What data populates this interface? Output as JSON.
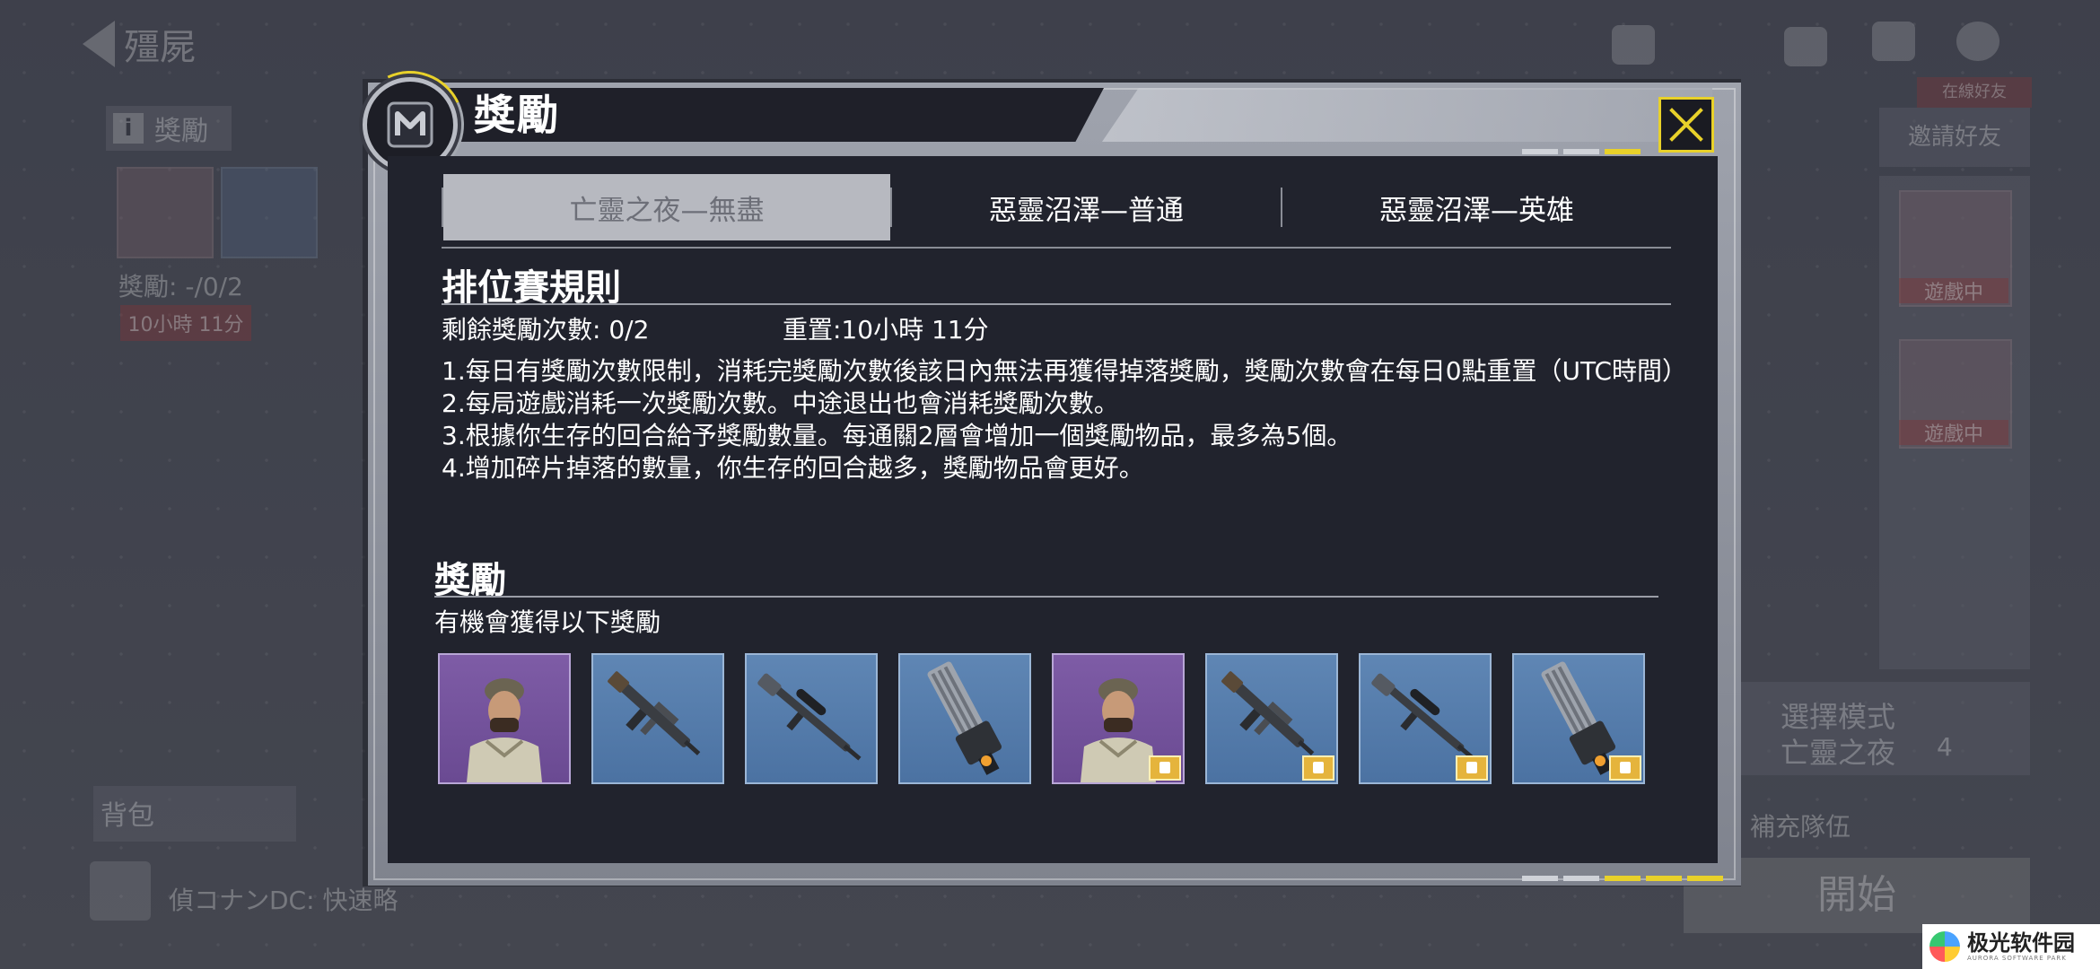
{
  "background": {
    "back_label": "殭屍",
    "rewards_tag": "獎勵",
    "rewards_count": "獎勵: -/0/2",
    "red_chip": "10小時 11分",
    "backpack": "背包",
    "chat_line": "偵コナンDC: 快速略",
    "mode_label": "選擇模式",
    "mode_name": "亡靈之夜",
    "party_count": "4",
    "replenish": "補充隊伍",
    "start": "開始",
    "invite": "邀請好友",
    "status_a": "遊戲中",
    "status_b": "遊戲中",
    "online_badge": "在線好友"
  },
  "modal": {
    "title": "獎勵",
    "close_icon": "close-x-icon",
    "tabs": [
      {
        "label": "亡靈之夜—無盡",
        "active": true
      },
      {
        "label": "惡靈沼澤—普通",
        "active": false
      },
      {
        "label": "惡靈沼澤—英雄",
        "active": false
      }
    ],
    "rules_title": "排位賽規則",
    "remaining": "剩餘獎勵次數: 0/2",
    "reset": "重置:10小時 11分",
    "rules": [
      "1.每日有獎勵次數限制，消耗完獎勵次數後該日內無法再獲得掉落獎勵，獎勵次數會在每日0點重置（UTC時間）",
      "2.每局遊戲消耗一次獎勵次數。中途退出也會消耗獎勵次數。",
      "3.根據你生存的回合給予獎勵數量。每通關2層會增加一個獎勵物品，最多為5個。",
      "4.增加碎片掉落的數量，你生存的回合越多，獎勵物品會更好。"
    ],
    "rewards_title": "獎勵",
    "rewards_subtitle": "有機會獲得以下獎勵",
    "items": [
      {
        "kind": "character",
        "rarity": "purple",
        "bonus": false
      },
      {
        "kind": "assault-rifle",
        "rarity": "blue",
        "bonus": false
      },
      {
        "kind": "sniper-rifle",
        "rarity": "blue",
        "bonus": false
      },
      {
        "kind": "minigun",
        "rarity": "blue",
        "bonus": false
      },
      {
        "kind": "character",
        "rarity": "purple",
        "bonus": true
      },
      {
        "kind": "assault-rifle",
        "rarity": "blue",
        "bonus": true
      },
      {
        "kind": "sniper-rifle",
        "rarity": "blue",
        "bonus": true
      },
      {
        "kind": "minigun",
        "rarity": "blue",
        "bonus": true
      }
    ]
  },
  "watermark": {
    "name": "极光软件园",
    "sub": "AURORA SOFTWARE PARK"
  },
  "colors": {
    "accent_yellow": "#e8d12a",
    "panel_dark": "#21232d",
    "rarity_purple": "#7e5ca6",
    "rarity_blue": "#5f86b4"
  }
}
